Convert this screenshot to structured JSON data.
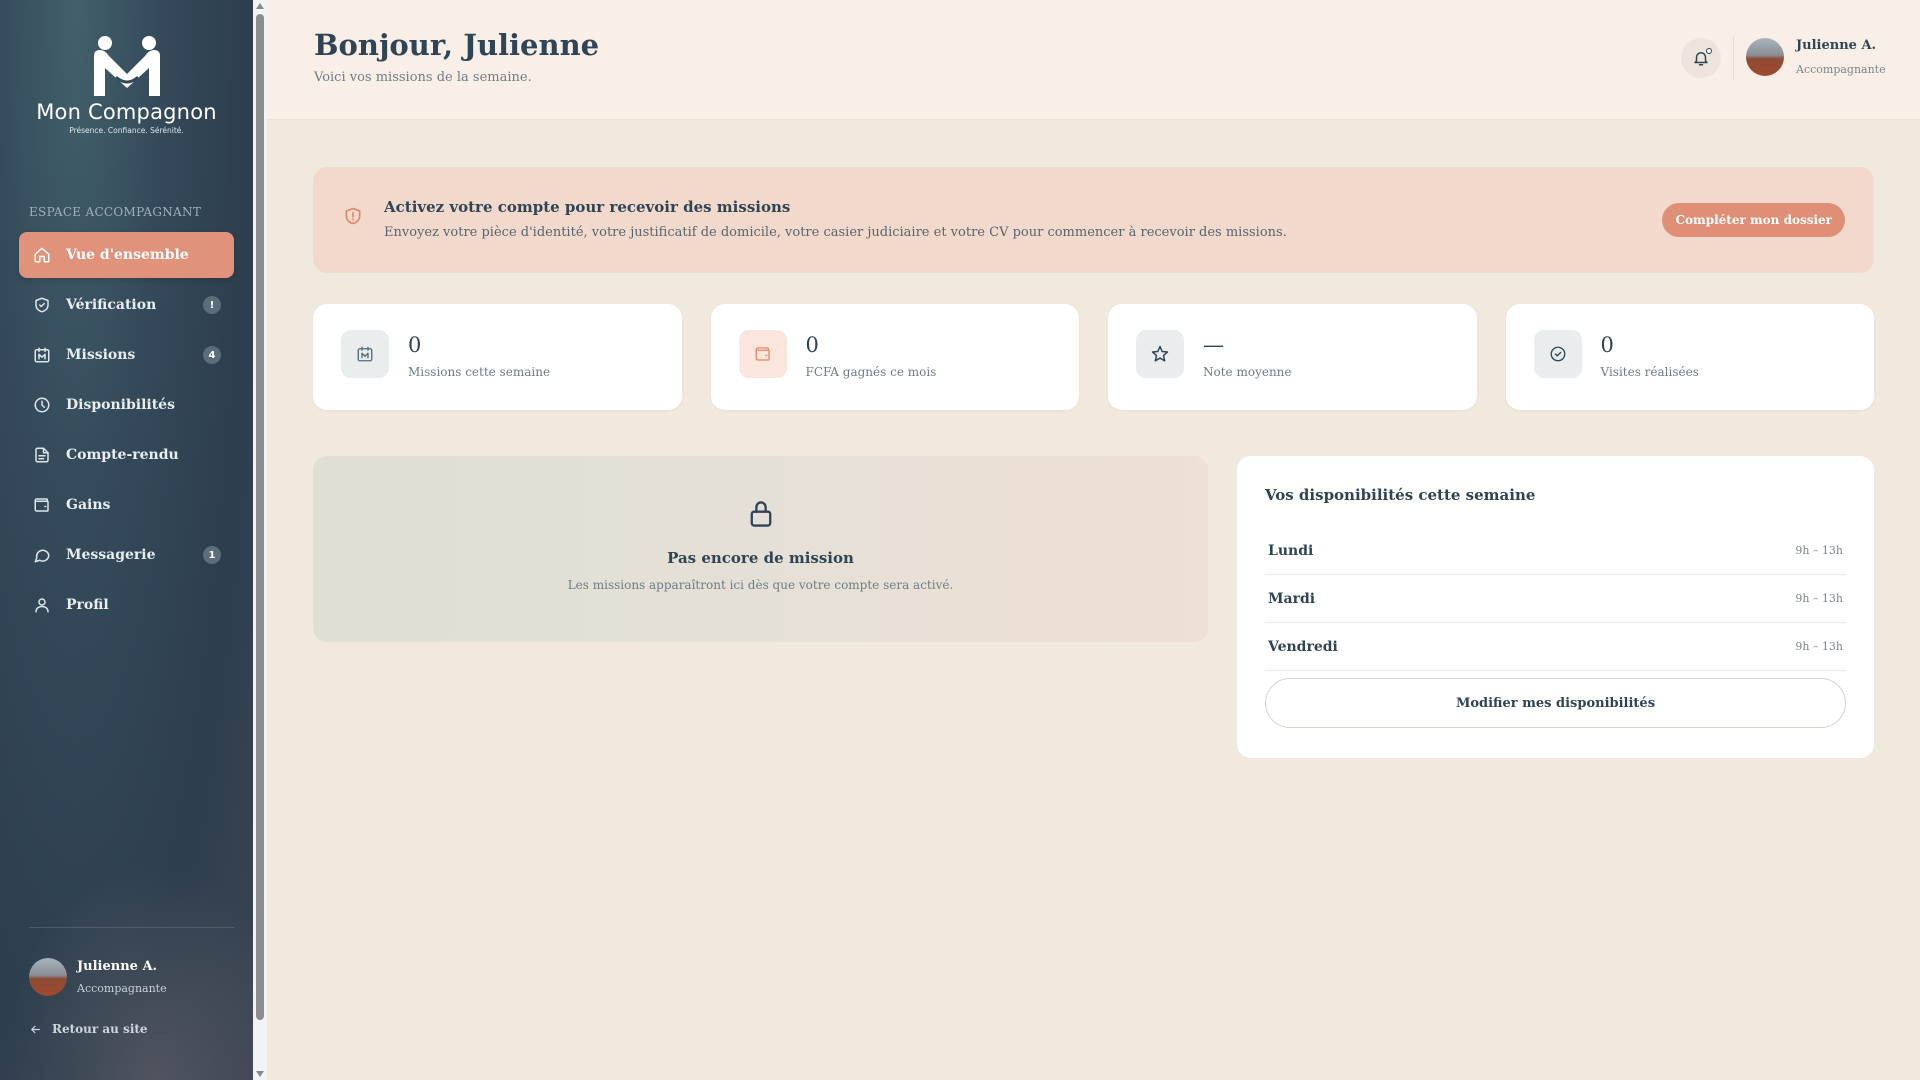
{
  "brand": {
    "name": "Mon Compagnon",
    "tagline": "Présence. Confiance. Sérénité."
  },
  "sidebar": {
    "section_label": "ESPACE ACCOMPAGNANT",
    "items": [
      {
        "label": "Vue d'ensemble",
        "icon": "home-icon",
        "active": true
      },
      {
        "label": "Vérification",
        "icon": "shield-check-icon",
        "badge": "!"
      },
      {
        "label": "Missions",
        "icon": "calendar-icon",
        "badge": "4"
      },
      {
        "label": "Disponibilités",
        "icon": "clock-icon"
      },
      {
        "label": "Compte-rendu",
        "icon": "document-icon"
      },
      {
        "label": "Gains",
        "icon": "wallet-icon"
      },
      {
        "label": "Messagerie",
        "icon": "chat-icon",
        "badge": "1"
      },
      {
        "label": "Profil",
        "icon": "user-icon"
      }
    ],
    "user": {
      "name": "Julienne A.",
      "role": "Accompagnante"
    },
    "back_link": "Retour au site"
  },
  "header": {
    "greeting": "Bonjour, Julienne",
    "subtitle": "Voici vos missions de la semaine.",
    "user": {
      "name": "Julienne A.",
      "role": "Accompagnante"
    }
  },
  "alert": {
    "title": "Activez votre compte pour recevoir des missions",
    "text": "Envoyez votre pièce d'identité, votre justificatif de domicile, votre casier judiciaire et votre CV pour commencer à recevoir des missions.",
    "button": "Compléter mon dossier"
  },
  "stats": [
    {
      "value": "0",
      "label": "Missions cette semaine",
      "icon": "calendar-icon"
    },
    {
      "value": "0",
      "label": "FCFA gagnés ce mois",
      "icon": "wallet-icon"
    },
    {
      "value": "—",
      "label": "Note moyenne",
      "icon": "star-icon"
    },
    {
      "value": "0",
      "label": "Visites réalisées",
      "icon": "check-circle-icon"
    }
  ],
  "empty_missions": {
    "title": "Pas encore de mission",
    "text": "Les missions apparaîtront ici dès que votre compte sera activé."
  },
  "availability": {
    "title": "Vos disponibilités cette semaine",
    "rows": [
      {
        "day": "Lundi",
        "hours": "9h – 13h"
      },
      {
        "day": "Mardi",
        "hours": "9h – 13h"
      },
      {
        "day": "Vendredi",
        "hours": "9h – 13h"
      }
    ],
    "button": "Modifier mes disponibilités"
  },
  "colors": {
    "accent": "#e0927a",
    "sidebar": "#2d3e4e",
    "background": "#f1e8de",
    "text": "#2f4556"
  }
}
